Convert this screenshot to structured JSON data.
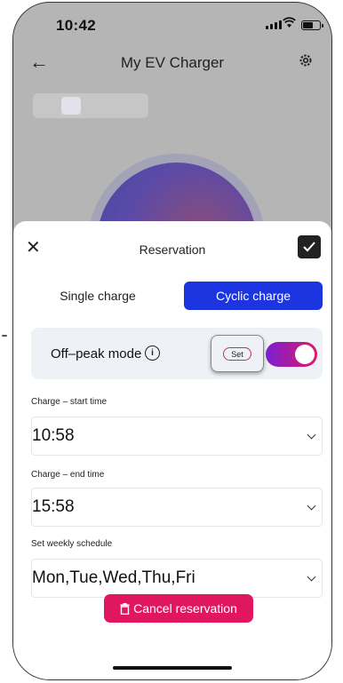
{
  "status_bar": {
    "time": "10:42"
  },
  "app": {
    "title": "My EV Charger"
  },
  "sheet": {
    "title": "Reservation",
    "tabs": [
      {
        "label": "Single charge",
        "active": false
      },
      {
        "label": "Cyclic charge",
        "active": true
      }
    ],
    "off_peak": {
      "label": "Off–peak mode",
      "set_label": "Set",
      "toggle_on": true
    },
    "fields": [
      {
        "label": "Charge – start time",
        "value": "10:58"
      },
      {
        "label": "Charge – end time",
        "value": "15:58"
      },
      {
        "label": "Set weekly schedule",
        "value": "Mon,Tue,Wed,Thu,Fri"
      }
    ],
    "cancel_label": "Cancel reservation"
  },
  "colors": {
    "accent_blue": "#1d35e0",
    "cancel_pink": "#e0175f",
    "toggle_start": "#7a1fd0",
    "toggle_end": "#e0196f"
  },
  "icons": [
    "back-arrow-icon",
    "gear-icon",
    "close-icon",
    "check-icon",
    "info-icon",
    "chevron-down-icon",
    "trash-icon",
    "wifi-icon",
    "signal-icon",
    "battery-icon"
  ]
}
